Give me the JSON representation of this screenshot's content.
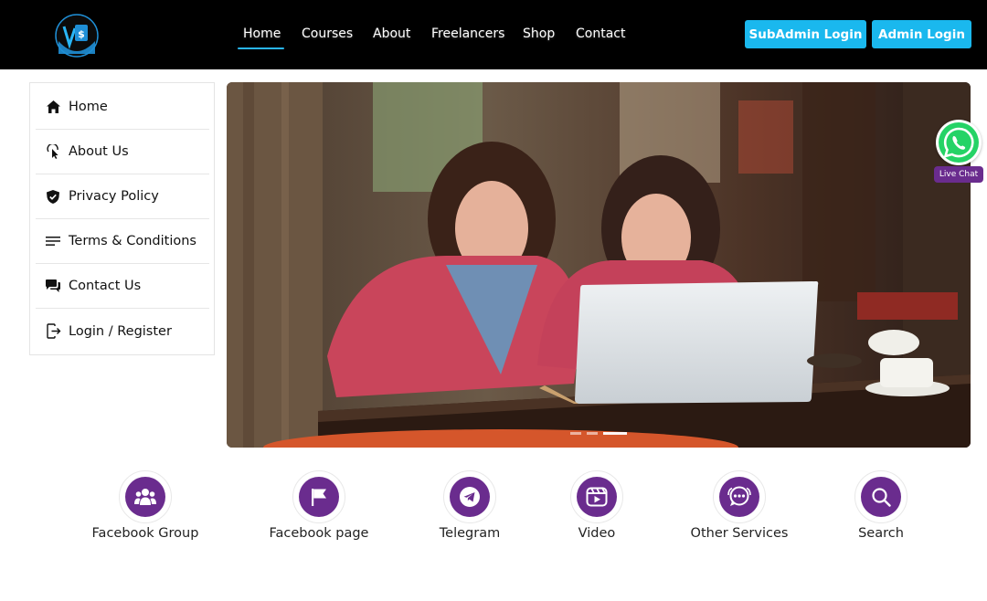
{
  "header": {
    "nav": [
      {
        "label": "Home"
      },
      {
        "label": "Courses"
      },
      {
        "label": "About"
      },
      {
        "label": "Freelancers"
      },
      {
        "label": "Shop"
      },
      {
        "label": "Contact"
      }
    ],
    "active_nav": "Home",
    "subadmin_login": "SubAdmin Login",
    "admin_login": "Admin Login"
  },
  "sidebar": {
    "items": [
      {
        "label": "Home",
        "icon": "home-icon"
      },
      {
        "label": "About Us",
        "icon": "pointer-icon"
      },
      {
        "label": "Privacy Policy",
        "icon": "shield-icon"
      },
      {
        "label": "Terms & Conditions",
        "icon": "lines-icon"
      },
      {
        "label": "Contact Us",
        "icon": "chat-icon"
      },
      {
        "label": "Login / Register",
        "icon": "login-icon"
      }
    ]
  },
  "whatsapp": {
    "badge": "Live Chat",
    "icon": "whatsapp-icon"
  },
  "services": [
    {
      "label": "Facebook Group",
      "icon": "group-icon"
    },
    {
      "label": "Facebook page",
      "icon": "flag-icon"
    },
    {
      "label": "Telegram",
      "icon": "telegram-icon"
    },
    {
      "label": "Video",
      "icon": "video-icon"
    },
    {
      "label": "Other Services",
      "icon": "support-chat-icon"
    },
    {
      "label": "Search",
      "icon": "search-icon"
    }
  ],
  "carousel": {
    "slides": 3,
    "active_slide": 3
  },
  "colors": {
    "header_bg": "#000000",
    "accent_blue": "#1ab8ee",
    "brand_purple": "#6a2c8e"
  }
}
